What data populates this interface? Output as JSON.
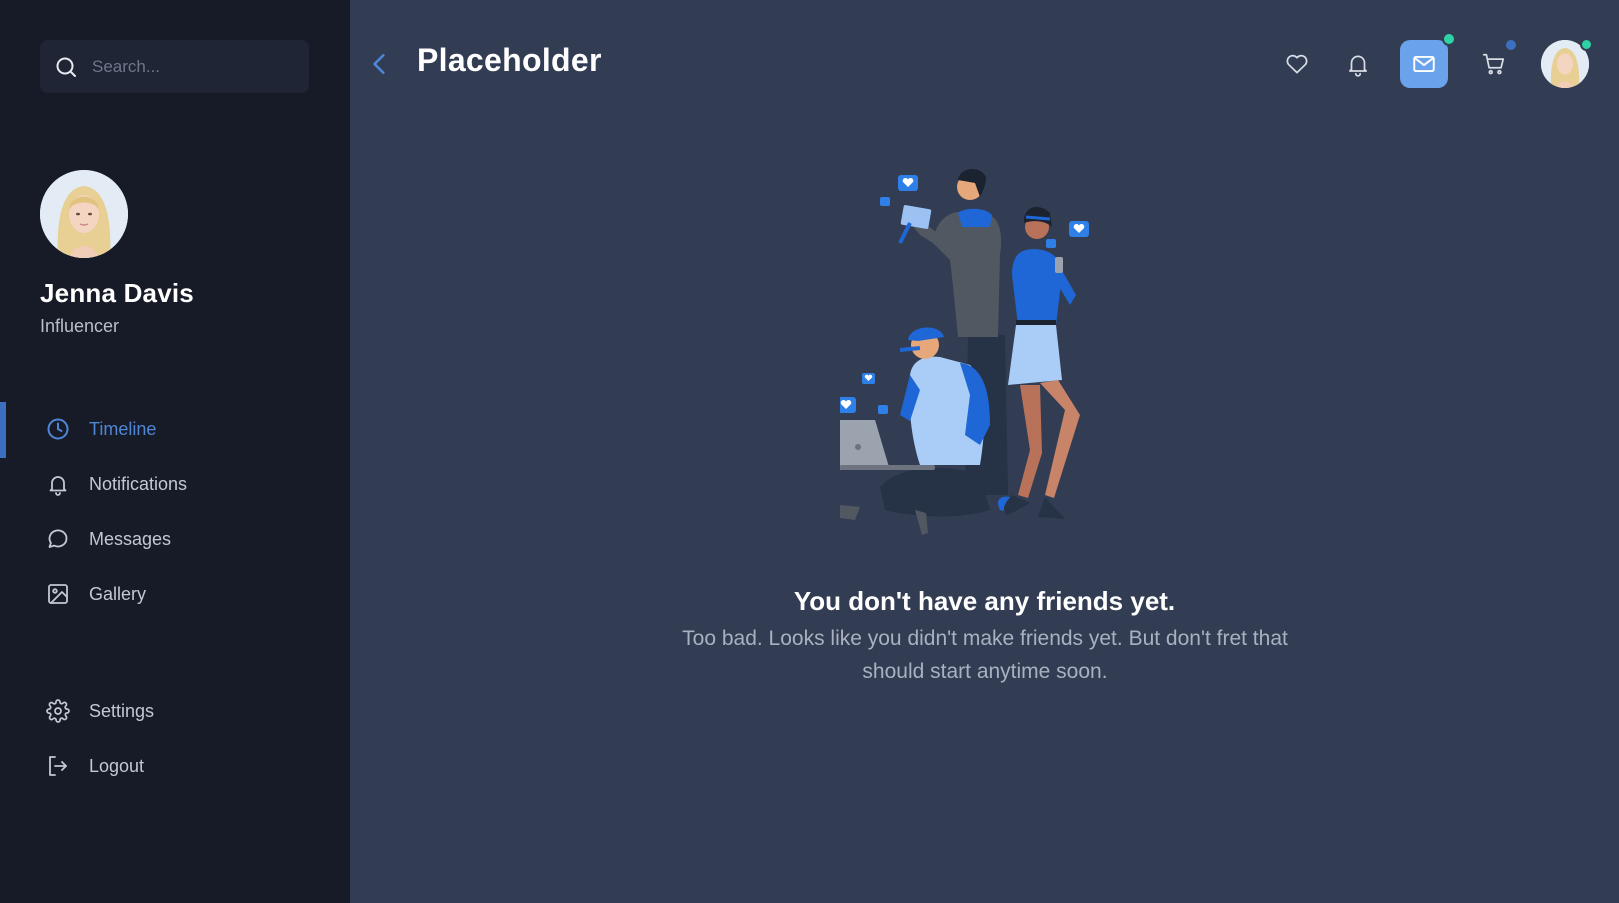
{
  "search": {
    "placeholder": "Search..."
  },
  "profile": {
    "name": "Jenna Davis",
    "role": "Influencer"
  },
  "nav": {
    "timeline": "Timeline",
    "notifications": "Notifications",
    "messages": "Messages",
    "gallery": "Gallery",
    "settings": "Settings",
    "logout": "Logout"
  },
  "header": {
    "title": "Placeholder"
  },
  "icons": {
    "back": "chevron-left-icon",
    "favorites": "heart-icon",
    "notifications": "bell-icon",
    "messages": "mail-icon",
    "cart": "cart-icon"
  },
  "colors": {
    "sidebar_bg": "#171b27",
    "main_bg": "#323c53",
    "accent": "#4f86d6",
    "mail_button": "#6aa2ec",
    "dot_green": "#2ed3a5",
    "dot_blue": "#3d6fc0"
  },
  "empty_state": {
    "title": "You don't have any friends yet.",
    "message": "Too bad. Looks like you didn't make friends yet. But don't fret that should start anytime soon."
  }
}
